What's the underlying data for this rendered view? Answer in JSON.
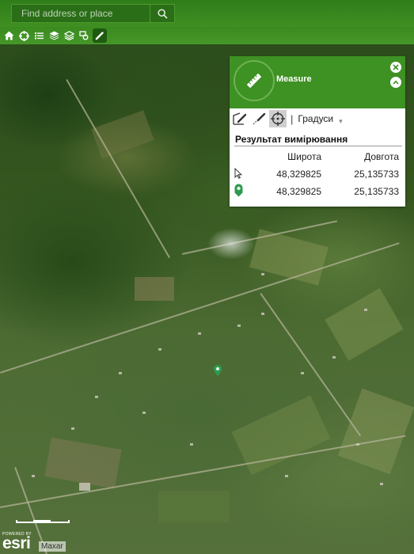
{
  "search": {
    "placeholder": "Find address or place"
  },
  "toolbar": {
    "tools": [
      {
        "name": "home",
        "icon": "home-icon"
      },
      {
        "name": "locate",
        "icon": "crosshair-icon"
      },
      {
        "name": "legend",
        "icon": "list-icon"
      },
      {
        "name": "layers",
        "icon": "layers-icon"
      },
      {
        "name": "basemap",
        "icon": "basemap-layers-icon"
      },
      {
        "name": "select",
        "icon": "select-icon"
      },
      {
        "name": "measure",
        "icon": "pencil-icon",
        "active": true
      }
    ]
  },
  "panel": {
    "title": "Measure",
    "units": "Градуси",
    "result_title": "Результат вимірювання",
    "columns": {
      "lat": "Широта",
      "lon": "Довгота"
    },
    "rows": [
      {
        "icon": "cursor-icon",
        "lat": "48,329825",
        "lon": "25,135733"
      },
      {
        "icon": "map-marker-icon",
        "lat": "48,329825",
        "lon": "25,135733"
      }
    ]
  },
  "footer": {
    "powered_by": "POWERED BY",
    "logo": "esri",
    "attribution": "Maxar"
  },
  "colors": {
    "accent": "#3e9123",
    "toolbar": "#3a8a1f",
    "pin": "#2e9b4f"
  }
}
